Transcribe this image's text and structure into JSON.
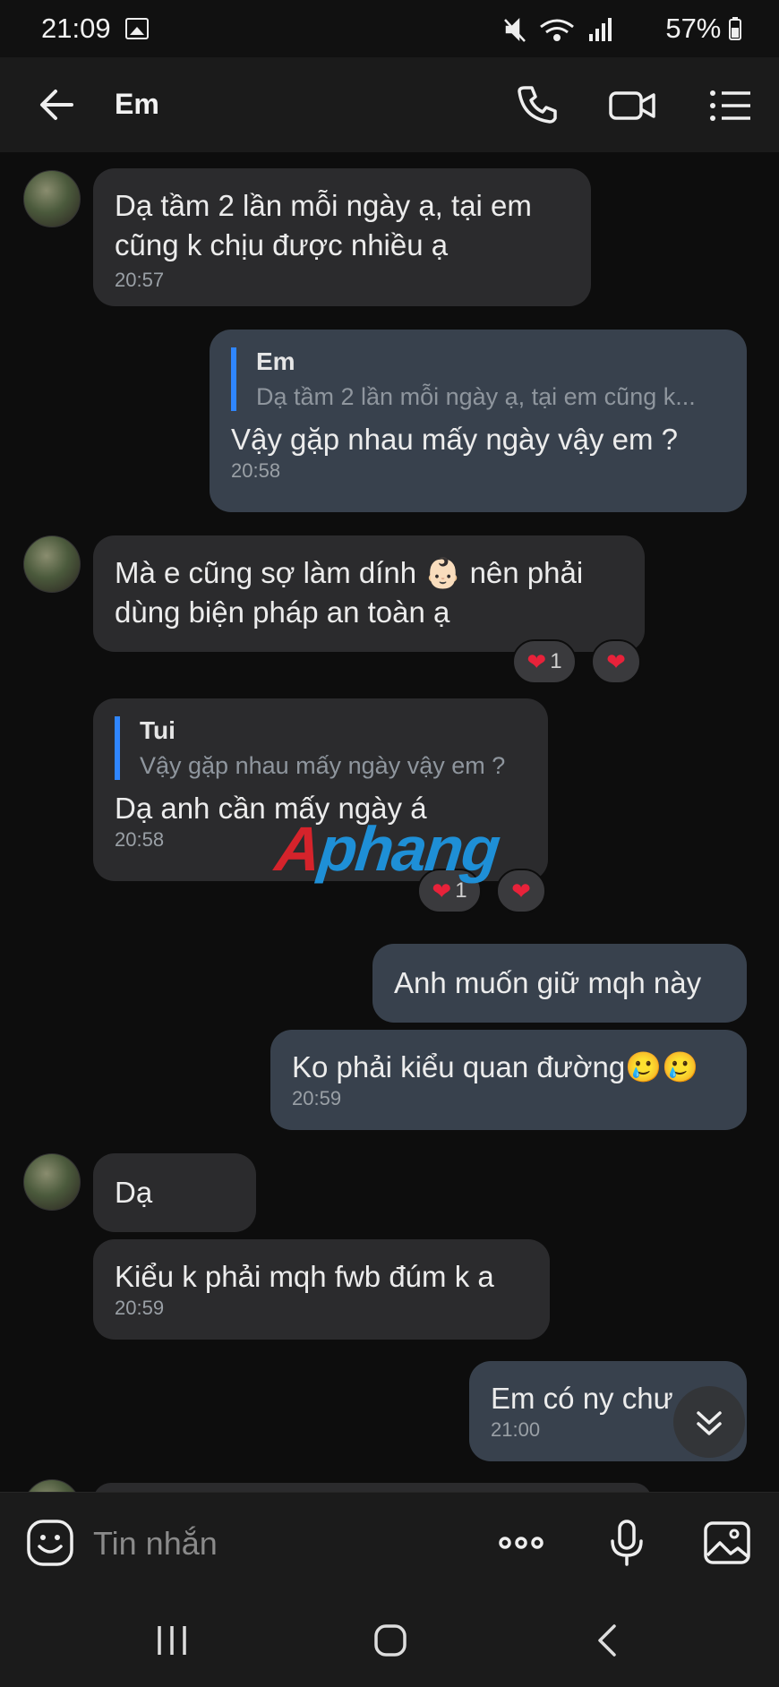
{
  "status_bar": {
    "time": "21:09",
    "battery": "57%"
  },
  "header": {
    "title": "Em"
  },
  "messages": [
    {
      "id": "m1",
      "dir": "in",
      "text_lines": [
        "Dạ tầm 2 lần mỗi ngày ạ, tại em",
        "cũng k chịu được nhiều ạ"
      ],
      "time": "20:57"
    },
    {
      "id": "m2",
      "dir": "out",
      "quote_name": "Em",
      "quote_text": "Dạ tầm 2 lần mỗi ngày ạ, tại em cũng k...",
      "text": "Vậy gặp nhau mấy ngày vậy em ?",
      "time": "20:58"
    },
    {
      "id": "m3",
      "dir": "in",
      "text_lines": [
        "Mà e cũng sợ làm dính 👶🏻 nên phải",
        "dùng biện pháp an toàn ạ"
      ],
      "reaction_count": "1"
    },
    {
      "id": "m4",
      "dir": "in",
      "quote_name": "Tui",
      "quote_text": "Vậy gặp nhau mấy ngày vậy em ?",
      "text": "Dạ anh cần mấy ngày á",
      "time": "20:58",
      "reaction_count": "1"
    },
    {
      "id": "m5",
      "dir": "out",
      "text": "Anh muốn giữ mqh này"
    },
    {
      "id": "m6",
      "dir": "out",
      "text": "Ko phải kiểu quan đường🥲🥲",
      "time": "20:59"
    },
    {
      "id": "m7",
      "dir": "in",
      "text": "Dạ"
    },
    {
      "id": "m8",
      "dir": "in",
      "text": "Kiểu k phải mqh fwb đúm k a",
      "time": "20:59"
    },
    {
      "id": "m9",
      "dir": "out",
      "text": "Em có ny chư",
      "time": "21:00"
    }
  ],
  "watermark": {
    "part1": "A",
    "part2": "phang"
  },
  "input": {
    "placeholder": "Tin nhắn"
  },
  "colors": {
    "bubble_in": "#2b2b2d",
    "bubble_out": "#38414d",
    "quote_bar": "#2f86ff",
    "heart": "#e8223a"
  },
  "icons": [
    "back-arrow-icon",
    "phone-icon",
    "video-call-icon",
    "menu-list-icon",
    "emoji-icon",
    "more-options-icon",
    "microphone-icon",
    "gallery-icon",
    "scroll-down-icon",
    "recents-icon",
    "home-icon",
    "nav-back-icon"
  ]
}
